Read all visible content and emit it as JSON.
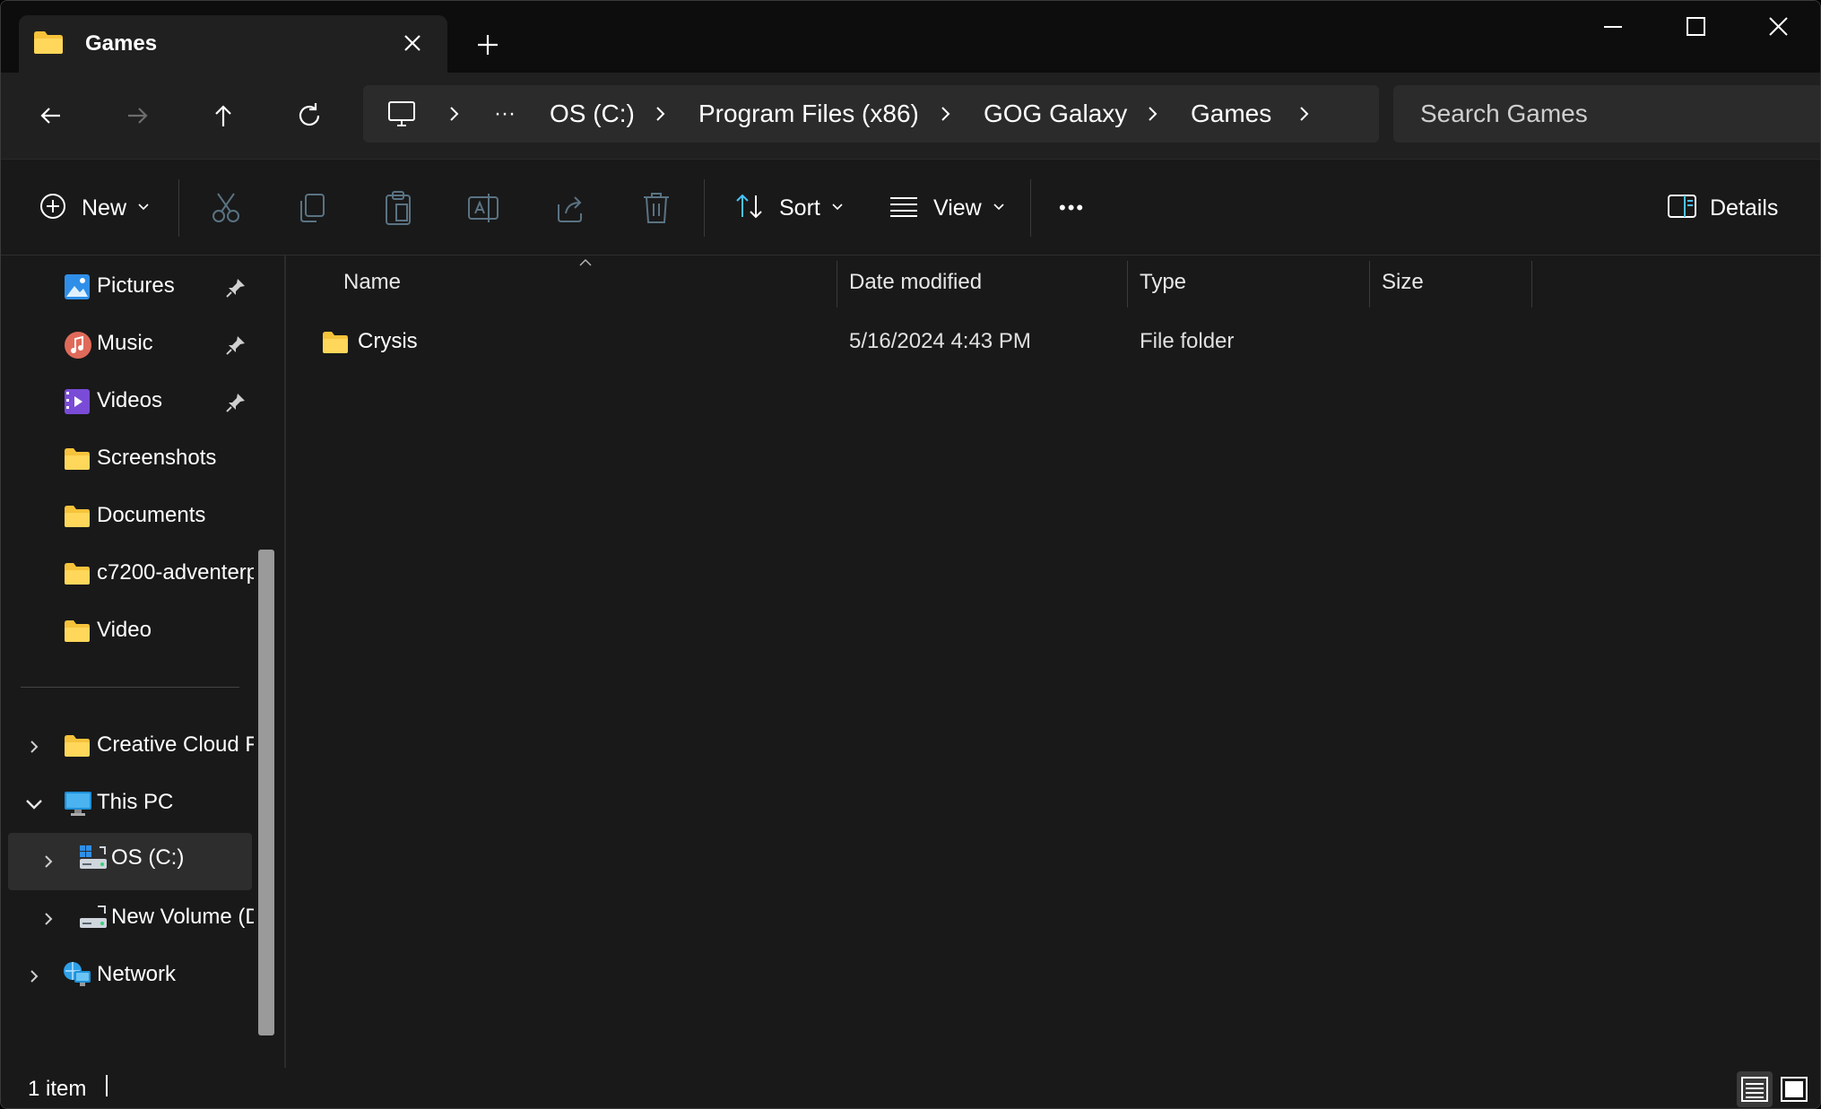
{
  "window": {
    "tab_title": "Games",
    "tab_close_label": "Close tab",
    "new_tab_label": "New tab"
  },
  "nav": {
    "back": "Back",
    "forward": "Forward",
    "up": "Up",
    "refresh": "Refresh"
  },
  "breadcrumb": {
    "overflow": "···",
    "items": [
      "OS (C:)",
      "Program Files (x86)",
      "GOG Galaxy",
      "Games"
    ]
  },
  "search": {
    "placeholder": "Search Games"
  },
  "toolbar": {
    "new_label": "New",
    "sort_label": "Sort",
    "view_label": "View",
    "more_label": "•••",
    "details_label": "Details"
  },
  "sidebar": {
    "quick_access": [
      {
        "label": "Pictures",
        "icon": "pictures-icon",
        "pinned": true
      },
      {
        "label": "Music",
        "icon": "music-icon",
        "pinned": true
      },
      {
        "label": "Videos",
        "icon": "videos-icon",
        "pinned": true
      },
      {
        "label": "Screenshots",
        "icon": "folder-icon",
        "pinned": false
      },
      {
        "label": "Documents",
        "icon": "folder-icon",
        "pinned": false
      },
      {
        "label": "c7200-adventerp",
        "icon": "folder-icon",
        "pinned": false
      },
      {
        "label": "Video",
        "icon": "folder-icon",
        "pinned": false
      }
    ],
    "tree": [
      {
        "label": "Creative Cloud F",
        "icon": "folder-icon",
        "expander": "collapsed"
      },
      {
        "label": "This PC",
        "icon": "this-pc-icon",
        "expander": "expanded"
      },
      {
        "label": "OS (C:)",
        "icon": "drive-os-icon",
        "expander": "collapsed",
        "selected": true
      },
      {
        "label": "New Volume (D",
        "icon": "drive-icon",
        "expander": "collapsed"
      },
      {
        "label": "Network",
        "icon": "network-icon",
        "expander": "collapsed"
      }
    ]
  },
  "columns": {
    "name": "Name",
    "date_modified": "Date modified",
    "type": "Type",
    "size": "Size"
  },
  "files": [
    {
      "name": "Crysis",
      "date_modified": "5/16/2024 4:43 PM",
      "type": "File folder",
      "size": ""
    }
  ],
  "status": {
    "item_count": "1 item"
  },
  "colors": {
    "window_bg": "#191919",
    "titlebar_bg": "#0d0d0d",
    "folder_yellow": "#f6c33b",
    "accent_blue": "#4cc2ff"
  }
}
